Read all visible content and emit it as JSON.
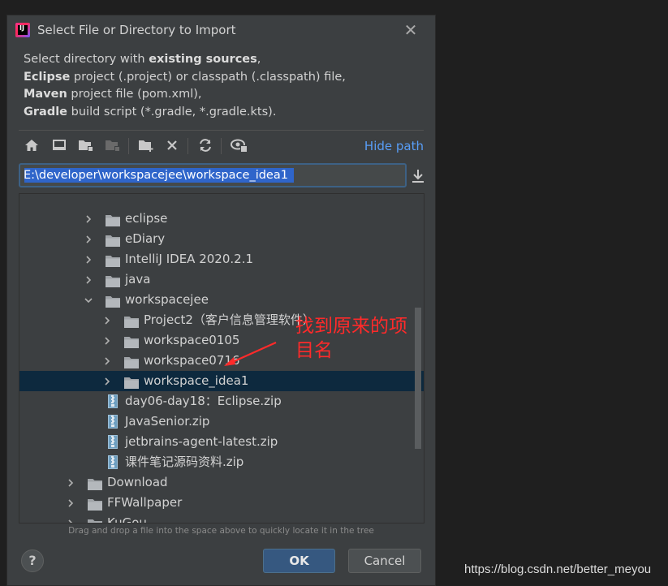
{
  "dialog": {
    "title": "Select File or Directory to Import",
    "close_glyph": "✕"
  },
  "description": {
    "line1_pre": "Select directory with ",
    "line1_bold": "existing sources",
    "line1_post": ",",
    "line2_bold": "Eclipse",
    "line2_post": " project (.project) or classpath (.classpath) file,",
    "line3_bold": "Maven",
    "line3_post": " project file (pom.xml),",
    "line4_bold": "Gradle",
    "line4_post": " build script (*.gradle, *.gradle.kts)."
  },
  "toolbar": {
    "icons": [
      "home-icon",
      "desktop-icon",
      "project-folder-icon",
      "module-folder-icon",
      "new-folder-icon",
      "delete-icon",
      "refresh-icon",
      "show-hidden-icon"
    ],
    "hide_path_label": "Hide path"
  },
  "path": {
    "value": "E:\\developer\\workspacejee\\workspace_idea1"
  },
  "tree": {
    "rows": [
      {
        "label": "eclipse",
        "type": "folder",
        "expanded": false
      },
      {
        "label": "eDiary",
        "type": "folder",
        "expanded": false
      },
      {
        "label": "IntelliJ IDEA 2020.2.1",
        "type": "folder",
        "expanded": false
      },
      {
        "label": "java",
        "type": "folder",
        "expanded": false
      },
      {
        "label": "workspacejee",
        "type": "folder",
        "expanded": true
      },
      {
        "label": "Project2（客户信息管理软件）",
        "type": "folder",
        "expanded": false
      },
      {
        "label": "workspace0105",
        "type": "folder",
        "expanded": false
      },
      {
        "label": "workspace0716",
        "type": "folder",
        "expanded": false
      },
      {
        "label": "workspace_idea1",
        "type": "folder",
        "expanded": false,
        "selected": true
      },
      {
        "label": "day06-day18：Eclipse.zip",
        "type": "zip"
      },
      {
        "label": "JavaSenior.zip",
        "type": "zip"
      },
      {
        "label": "jetbrains-agent-latest.zip",
        "type": "zip"
      },
      {
        "label": "课件笔记源码资料.zip",
        "type": "zip"
      },
      {
        "label": "Download",
        "type": "folder",
        "expanded": false
      },
      {
        "label": "FFWallpaper",
        "type": "folder",
        "expanded": false
      },
      {
        "label": "KuGou",
        "type": "folder",
        "expanded": false
      }
    ]
  },
  "annotation": {
    "text": "找到原来的项目名",
    "color": "#ff2a2a"
  },
  "hint": "Drag and drop a file into the space above to quickly locate it in the tree",
  "buttons": {
    "help": "?",
    "ok": "OK",
    "cancel": "Cancel"
  },
  "watermark": "https://blog.csdn.net/better_meyou",
  "colors": {
    "background": "#3c3f41",
    "accent": "#589df6",
    "selection": "#0d293e",
    "ok": "#365880"
  }
}
